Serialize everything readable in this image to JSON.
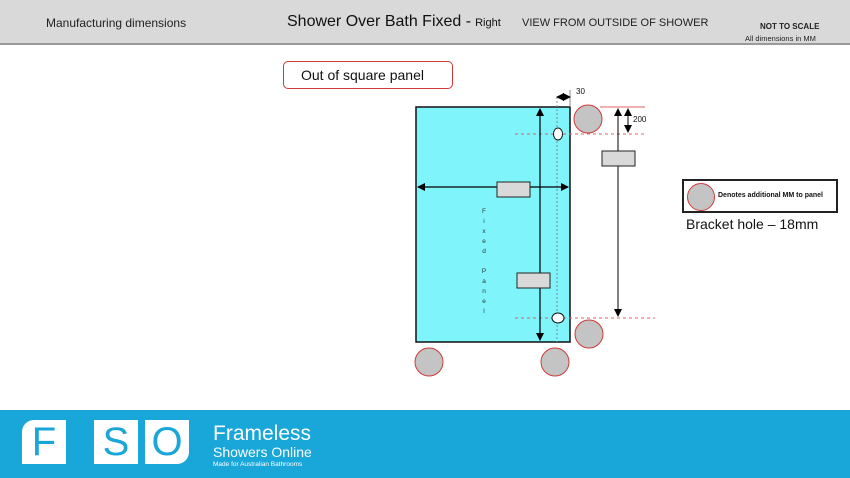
{
  "header": {
    "left_label": "Manufacturing dimensions",
    "title": "Shower Over Bath Fixed -",
    "side": "Right",
    "view": "VIEW FROM OUTSIDE OF SHOWER",
    "not_to_scale": "NOT TO SCALE",
    "dims_note": "All dimensions in MM"
  },
  "callout": {
    "label": "Out of square panel"
  },
  "diagram": {
    "panel_label_chars": [
      "F",
      "i",
      "x",
      "e",
      "d",
      "",
      "P",
      "a",
      "n",
      "e",
      "l"
    ],
    "dim_top": "30",
    "dim_side": "200",
    "colors": {
      "panel": "#7ff5fb",
      "marker_fill": "#c4c4c4",
      "marker_stroke": "#d03a3a",
      "dash": "#e06060"
    }
  },
  "legend": {
    "marker_text": "Denotes additional MM to panel",
    "bracket_hole": "Bracket hole – 18mm"
  },
  "footer": {
    "logo_letters": [
      "F",
      "S",
      "O"
    ],
    "brand_line1": "Frameless",
    "brand_line2": "Showers Online",
    "tagline": "Made for Australian Bathrooms"
  }
}
